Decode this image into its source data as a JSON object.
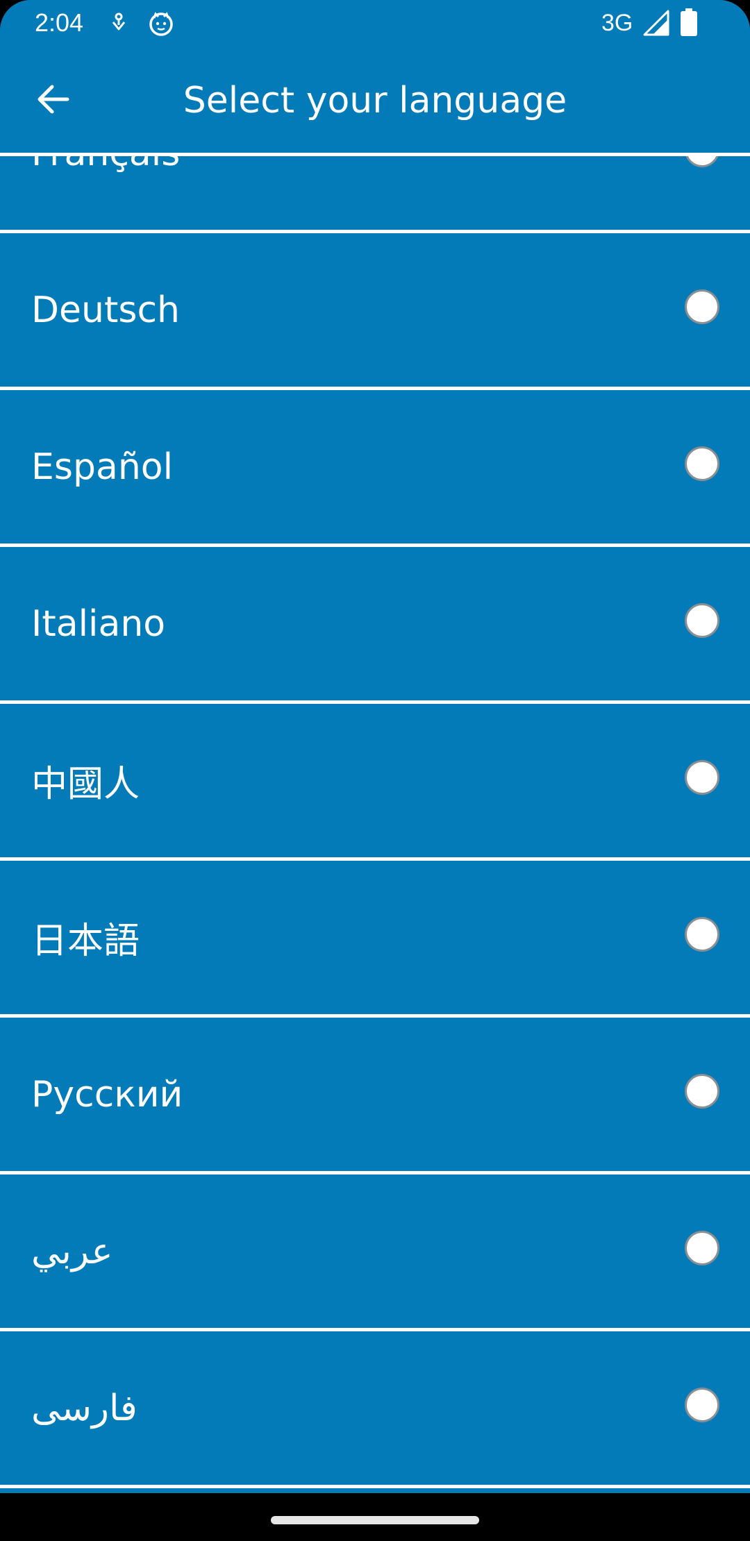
{
  "status_bar": {
    "time": "2:04",
    "network": "3G",
    "icons": [
      "notification-icon",
      "cat-face-icon",
      "signal-icon",
      "battery-icon"
    ]
  },
  "app_bar": {
    "title": "Select your language",
    "back_icon": "arrow-left-icon"
  },
  "languages": [
    {
      "label": "Français",
      "selected": false
    },
    {
      "label": "Deutsch",
      "selected": false
    },
    {
      "label": "Español",
      "selected": false
    },
    {
      "label": "Italiano",
      "selected": false
    },
    {
      "label": "中國人",
      "selected": false
    },
    {
      "label": "日本語",
      "selected": false
    },
    {
      "label": "Русский",
      "selected": false
    },
    {
      "label": "عربي",
      "selected": false
    },
    {
      "label": "فارسی",
      "selected": false
    }
  ],
  "colors": {
    "background": "#027bb8",
    "divider": "#ffffff",
    "text": "#ffffff",
    "nav_bar": "#000000"
  }
}
